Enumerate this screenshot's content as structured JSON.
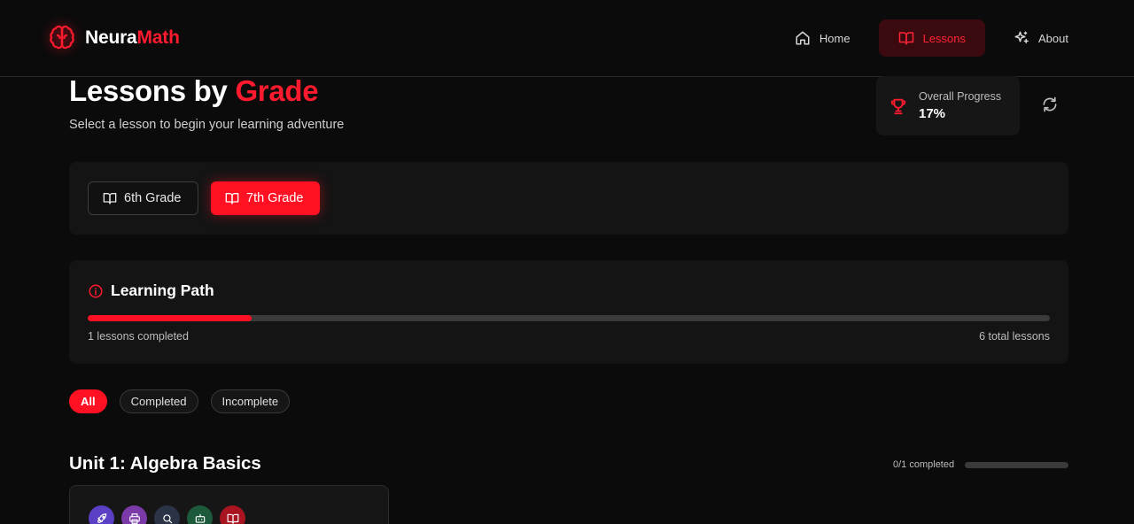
{
  "app": {
    "brand_part1": "Neura",
    "brand_part2": "Math",
    "accent_color": "#ff1022"
  },
  "nav": [
    {
      "label": "Home",
      "icon": "home-icon",
      "active": false
    },
    {
      "label": "Lessons",
      "icon": "book-icon",
      "active": true
    },
    {
      "label": "About",
      "icon": "sparkles-icon",
      "active": false
    }
  ],
  "page": {
    "title_part1": "Lessons by ",
    "title_part2": "Grade",
    "subtitle": "Select a lesson to begin your learning adventure"
  },
  "overall_progress": {
    "label": "Overall Progress",
    "value": "17%",
    "icon": "trophy-icon"
  },
  "grades": [
    {
      "label": "6th Grade",
      "selected": false
    },
    {
      "label": "7th Grade",
      "selected": true
    }
  ],
  "learning_path": {
    "title": "Learning Path",
    "completed_text": "1 lessons completed",
    "total_text": "6 total lessons",
    "progress_fraction": 0.17
  },
  "filters": [
    {
      "label": "All",
      "active": true
    },
    {
      "label": "Completed",
      "active": false
    },
    {
      "label": "Incomplete",
      "active": false
    }
  ],
  "units": [
    {
      "title": "Unit 1: Algebra Basics",
      "completed_text": "0/1 completed",
      "progress_fraction": 0,
      "lesson_badges": [
        {
          "icon": "rocket-icon",
          "color": "#5b3fc4"
        },
        {
          "icon": "printer-icon",
          "color": "#7a3aa8"
        },
        {
          "icon": "search-icon",
          "color": "#2b3446"
        },
        {
          "icon": "robot-icon",
          "color": "#1d5a3c"
        },
        {
          "icon": "book-open-icon",
          "color": "#a8141f"
        }
      ]
    }
  ]
}
